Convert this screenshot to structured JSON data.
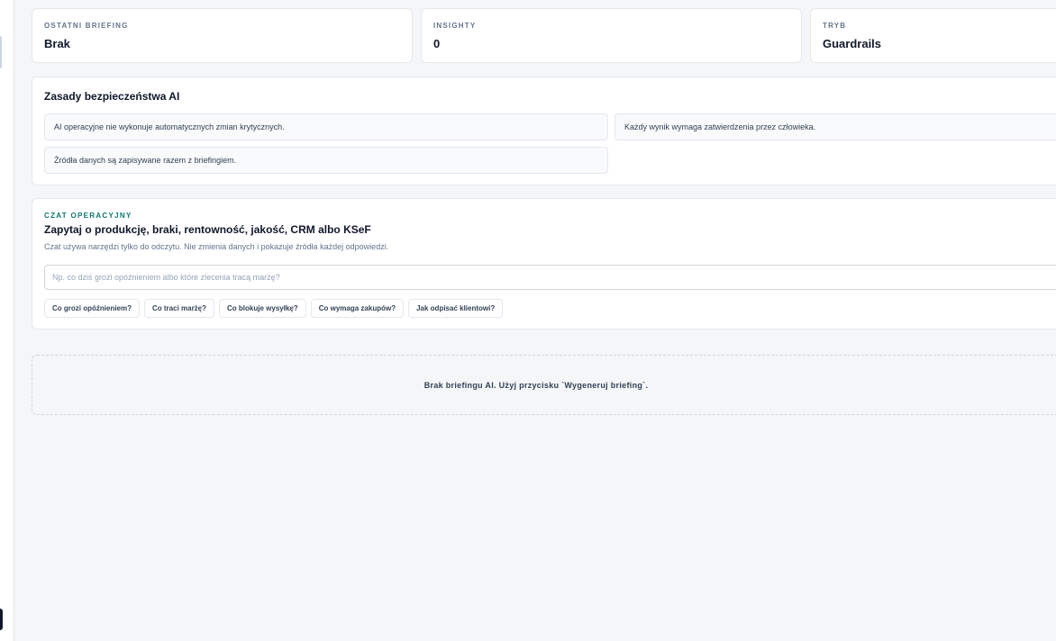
{
  "stats": [
    {
      "label": "OSTATNI BRIEFING",
      "value": "Brak"
    },
    {
      "label": "INSIGHTY",
      "value": "0"
    },
    {
      "label": "TRYB",
      "value": "Guardrails"
    }
  ],
  "rules": {
    "title": "Zasady bezpieczeństwa AI",
    "items": [
      "AI operacyjne nie wykonuje automatycznych zmian krytycznych.",
      "Każdy wynik wymaga zatwierdzenia przez człowieka.",
      "Źródła danych są zapisywane razem z briefingiem."
    ]
  },
  "chat": {
    "eyebrow": "CZAT OPERACYJNY",
    "title": "Zapytaj o produkcję, braki, rentowność, jakość, CRM albo KSeF",
    "description": "Czat używa narzędzi tylko do odczytu. Nie zmienia danych i pokazuje źródła każdej odpowiedzi.",
    "input_placeholder": "Np. co dziś grozi opóźnieniem albo które zlecenia tracą marżę?",
    "input_value": "",
    "suggestions": [
      "Co grozi opóźnieniem?",
      "Co traci marżę?",
      "Co blokuje wysyłkę?",
      "Co wymaga zakupów?",
      "Jak odpisać klientowi?"
    ]
  },
  "empty_state": {
    "message": "Brak briefingu AI. Użyj przycisku `Wygeneruj briefing`."
  }
}
